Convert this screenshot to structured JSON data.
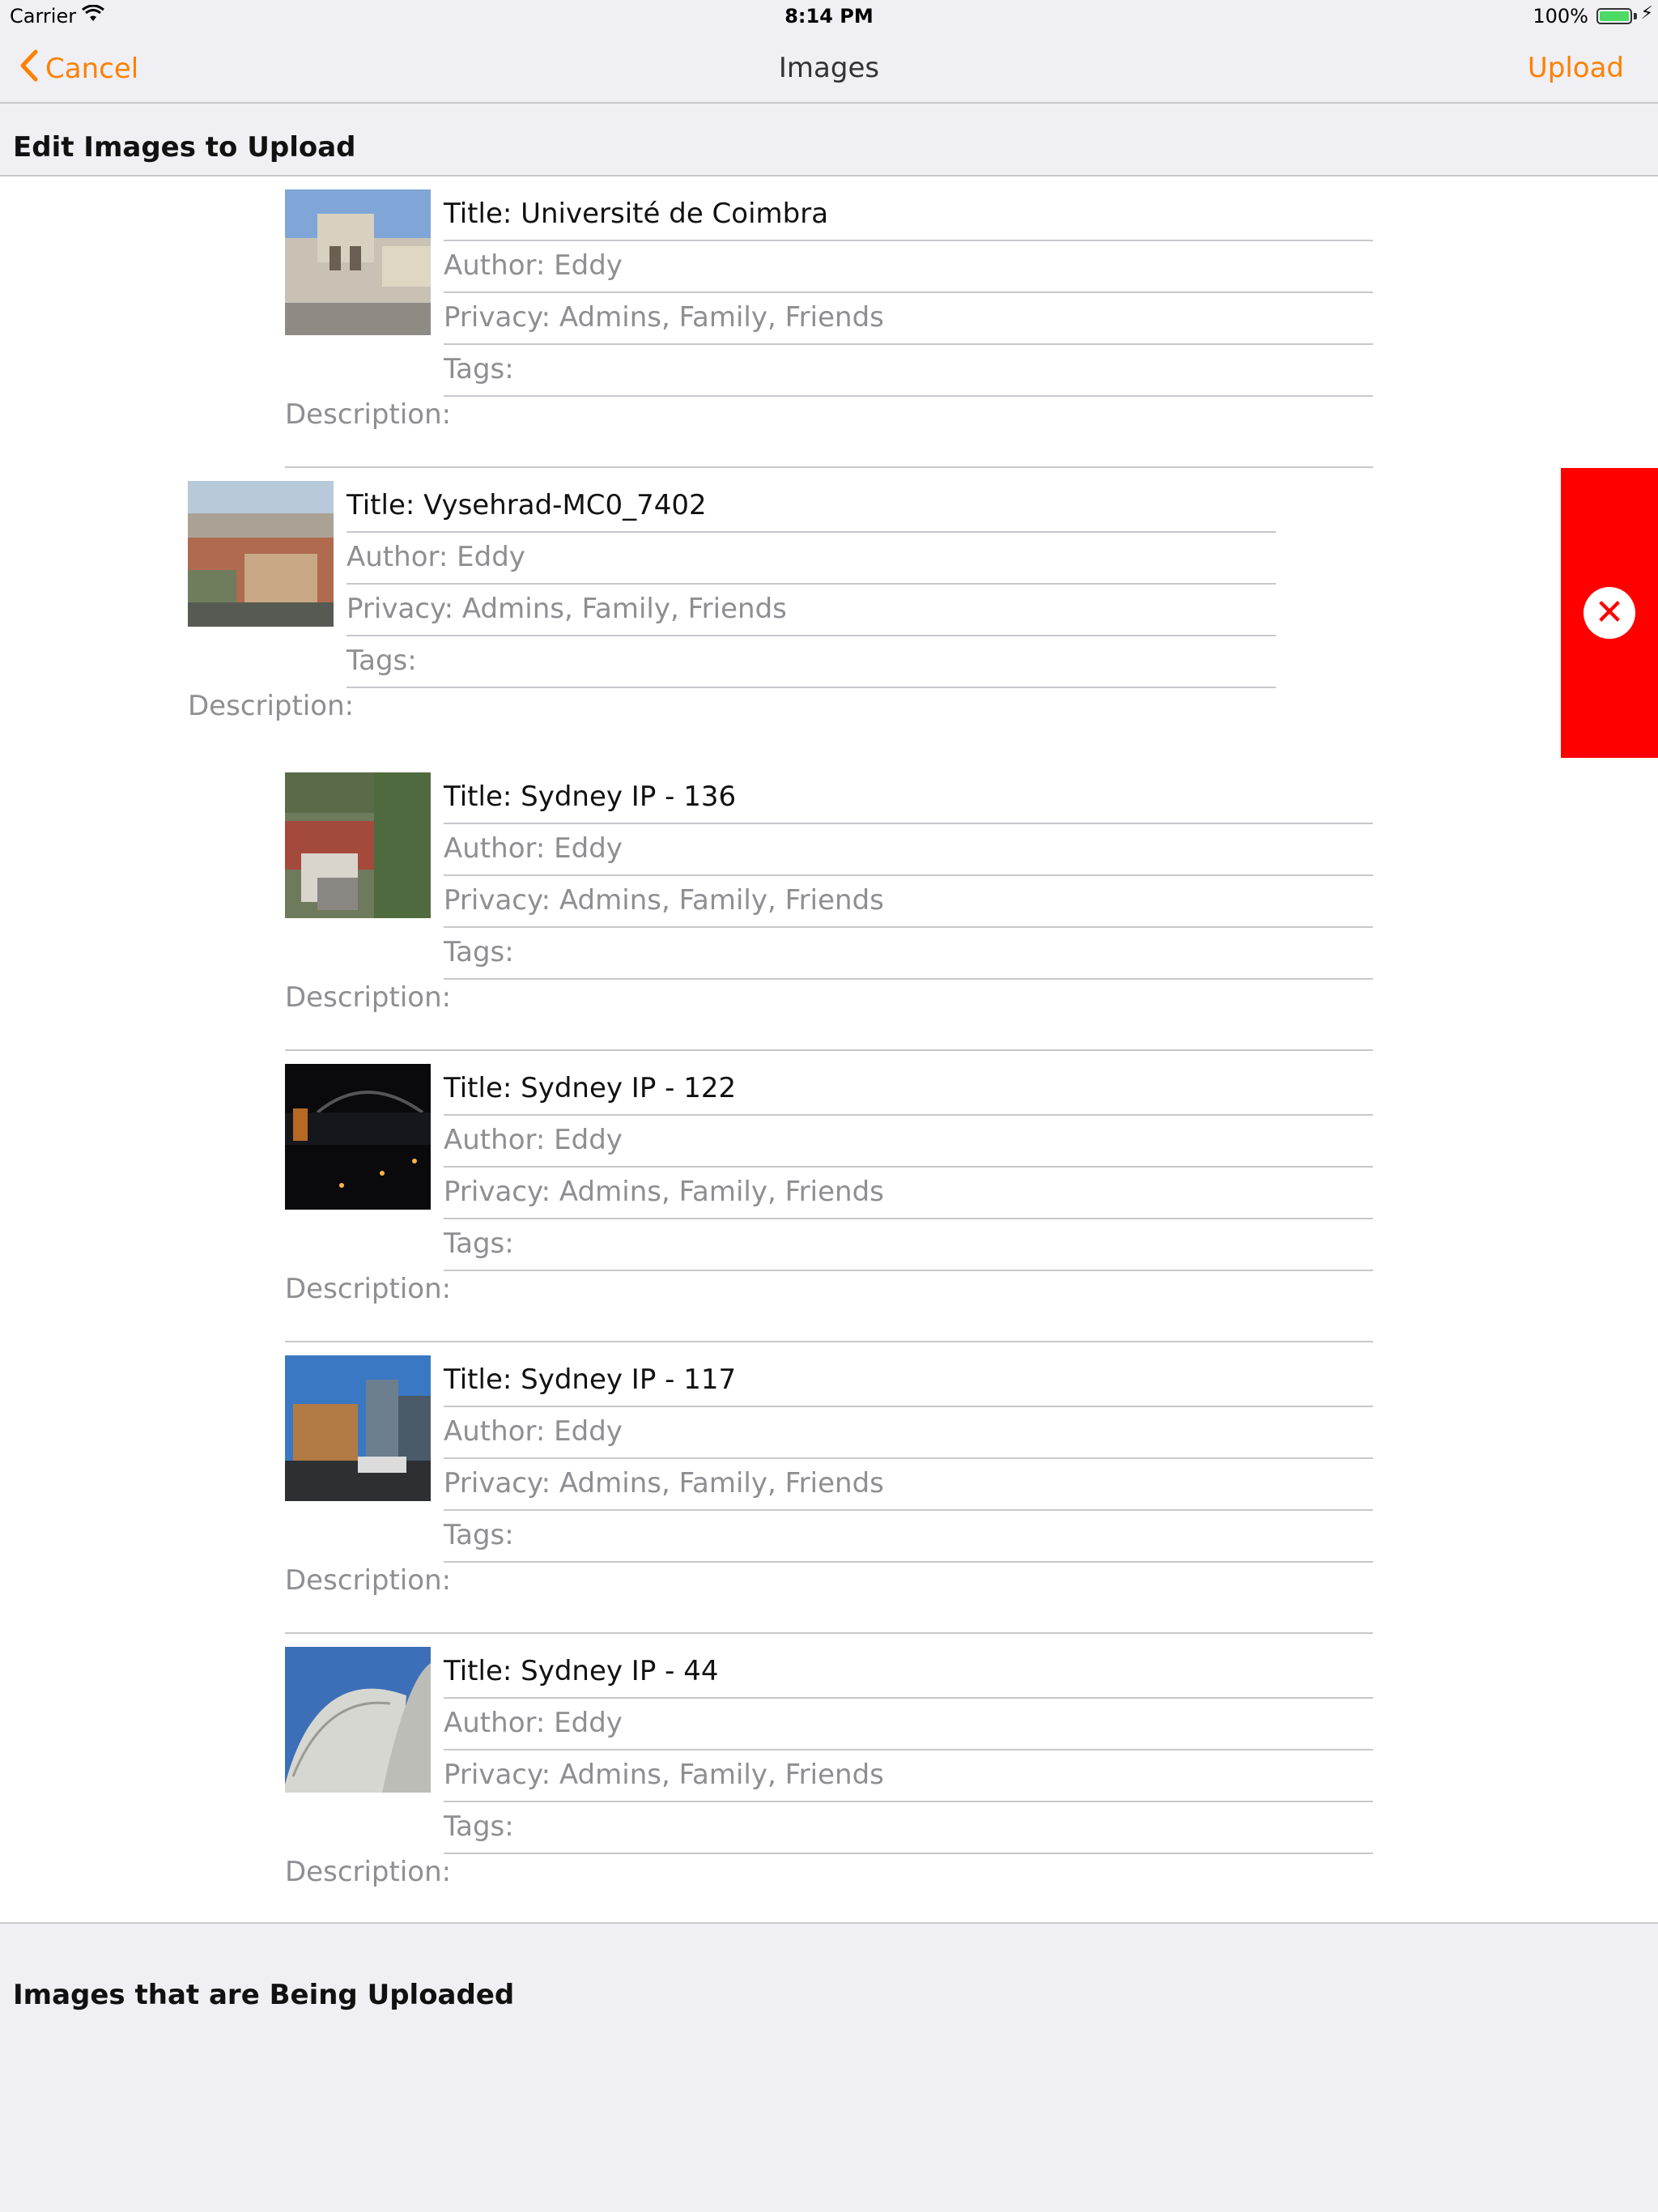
{
  "status_bar": {
    "carrier": "Carrier",
    "time": "8:14 PM",
    "battery": "100%",
    "battery_level": 1.0
  },
  "nav": {
    "cancel_label": "Cancel",
    "title": "Images",
    "upload_label": "Upload"
  },
  "sections": {
    "edit_header": "Edit Images to Upload",
    "uploading_header": "Images that are Being Uploaded"
  },
  "items": [
    {
      "title": "Title: Université de Coimbra",
      "author": "Author: Eddy",
      "privacy": "Privacy: Admins, Family, Friends",
      "tags": "Tags:",
      "description": "Description:"
    },
    {
      "title": "Title: Vysehrad-MC0_7402",
      "author": "Author: Eddy",
      "privacy": "Privacy: Admins, Family, Friends",
      "tags": "Tags:",
      "description": "Description:"
    },
    {
      "title": "Title: Sydney IP - 136",
      "author": "Author: Eddy",
      "privacy": "Privacy: Admins, Family, Friends",
      "tags": "Tags:",
      "description": "Description:"
    },
    {
      "title": "Title: Sydney IP - 122",
      "author": "Author: Eddy",
      "privacy": "Privacy: Admins, Family, Friends",
      "tags": "Tags:",
      "description": "Description:"
    },
    {
      "title": "Title: Sydney IP - 117",
      "author": "Author: Eddy",
      "privacy": "Privacy: Admins, Family, Friends",
      "tags": "Tags:",
      "description": "Description:"
    },
    {
      "title": "Title: Sydney IP - 44",
      "author": "Author: Eddy",
      "privacy": "Privacy: Admins, Family, Friends",
      "tags": "Tags:",
      "description": "Description:"
    }
  ],
  "delete_action": {
    "icon": "close-icon",
    "color": "#ff0000"
  },
  "colors": {
    "accent": "#ff8000",
    "background": "#efeff4",
    "separator": "#c8c7cc"
  }
}
